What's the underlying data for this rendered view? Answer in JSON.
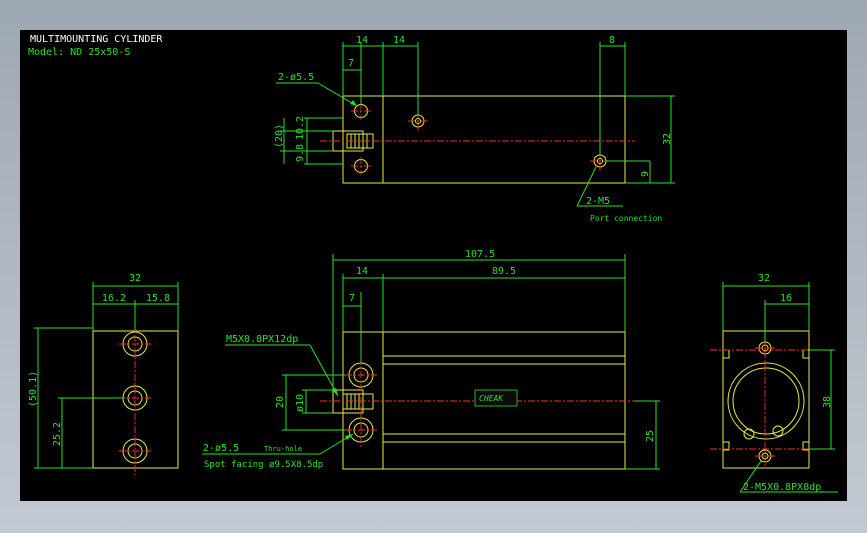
{
  "title": "MULTIMOUNTING CYLINDER",
  "model": "Model: ND 25x50-S",
  "top_view": {
    "dims": {
      "d14a": "14",
      "d14b": "14",
      "d8": "8",
      "d7": "7",
      "d20": "(20)",
      "d10_2": "10.2",
      "d9_8": "9.8",
      "d32": "32",
      "d9": "9"
    },
    "callout_hole": "2-ø5.5",
    "callout_port": "2-M5",
    "port_note": "Port connection"
  },
  "left_view": {
    "dims": {
      "d32": "32",
      "d16_2": "16.2",
      "d15_8": "15.8",
      "d50_1": "(50.1)",
      "d25_2": "25.2"
    }
  },
  "front_view": {
    "dims": {
      "d107_5": "107.5",
      "d14": "14",
      "d89_5": "89.5",
      "d7": "7",
      "d20": "20",
      "dphi10": "ø10",
      "d25": "25"
    },
    "callout_thread": "M5X0.8PX12dp",
    "callout_hole": "2-ø5.5",
    "callout_hole_note": "Thru-hole",
    "spot_facing": "Spot facing  ø9.5X8.5dp",
    "label_text": "CHEAK"
  },
  "right_view": {
    "dims": {
      "d32": "32",
      "d16": "16",
      "d38": "38"
    },
    "callout": "2-M5X0.8PX8dp"
  },
  "colors": {
    "outline": "#e8e84a",
    "dimension": "#27e327",
    "centerline": "#ff2a2a",
    "text": "#ffffff",
    "background": "#000000"
  }
}
